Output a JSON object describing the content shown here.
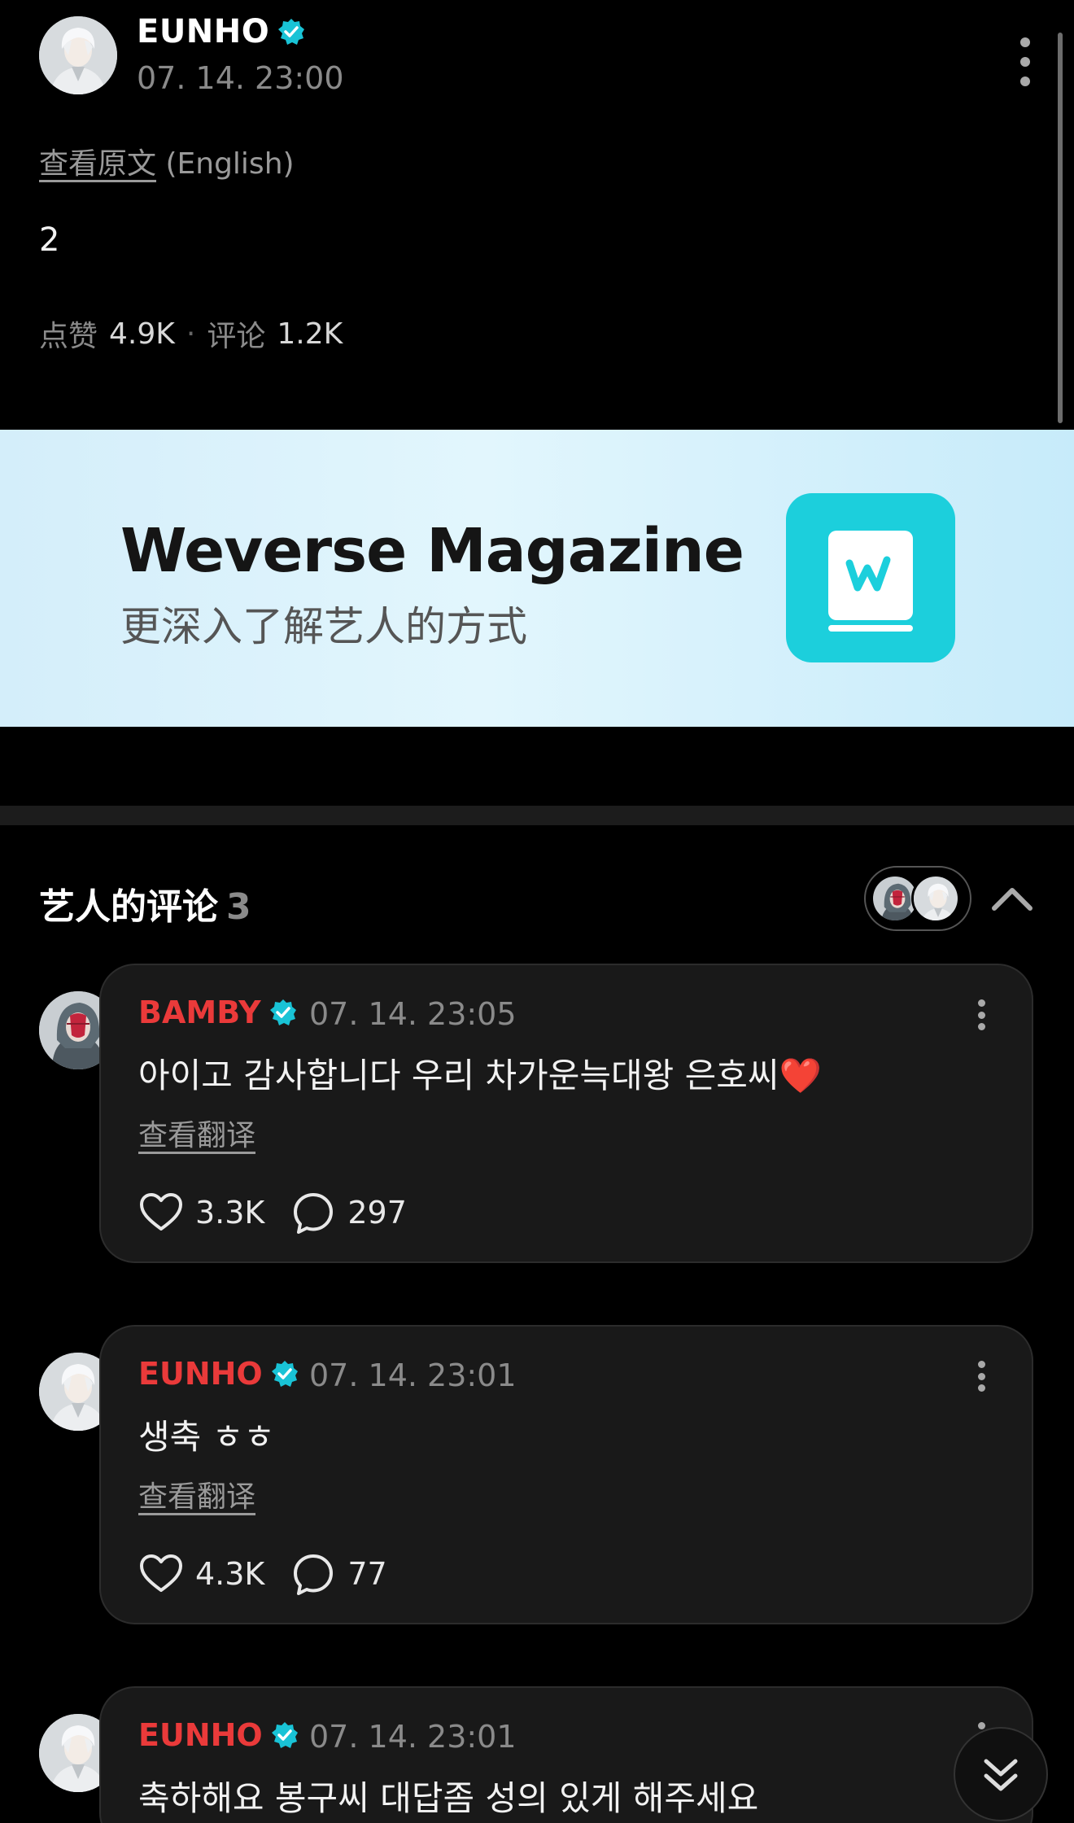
{
  "post": {
    "author": "EUNHO",
    "time": "07. 14. 23:00",
    "translate_link": "查看原文",
    "translate_lang": "(English)",
    "body": "2",
    "likes_label": "点赞",
    "likes_value": "4.9K",
    "separator": "·",
    "comments_label": "评论",
    "comments_value": "1.2K"
  },
  "banner": {
    "title": "Weverse Magazine",
    "subtitle": "更深入了解艺人的方式",
    "logo_icon": "weverse-magazine-book-icon"
  },
  "artist_comments": {
    "title": "艺人的评论",
    "count": "3"
  },
  "comments": [
    {
      "author": "BAMBY",
      "time": "07. 14. 23:05",
      "text": "아이고 감사합니다 우리 차가운늑대왕 은호씨❤️",
      "translate": "查看翻译",
      "likes": "3.3K",
      "replies": "297"
    },
    {
      "author": "EUNHO",
      "time": "07. 14. 23:01",
      "text": "생축 ㅎㅎ",
      "translate": "查看翻译",
      "likes": "4.3K",
      "replies": "77"
    },
    {
      "author": "EUNHO",
      "time": "07. 14. 23:01",
      "text": "축하해요 봉구씨 대답좀 성의 있게 해주세요"
    }
  ],
  "colors": {
    "background": "#000000",
    "card": "#191919",
    "author_red": "#ea3a3a",
    "verified": "#19c3d6",
    "muted": "#8a8a8a",
    "banner_logo": "#1ccfdc"
  }
}
